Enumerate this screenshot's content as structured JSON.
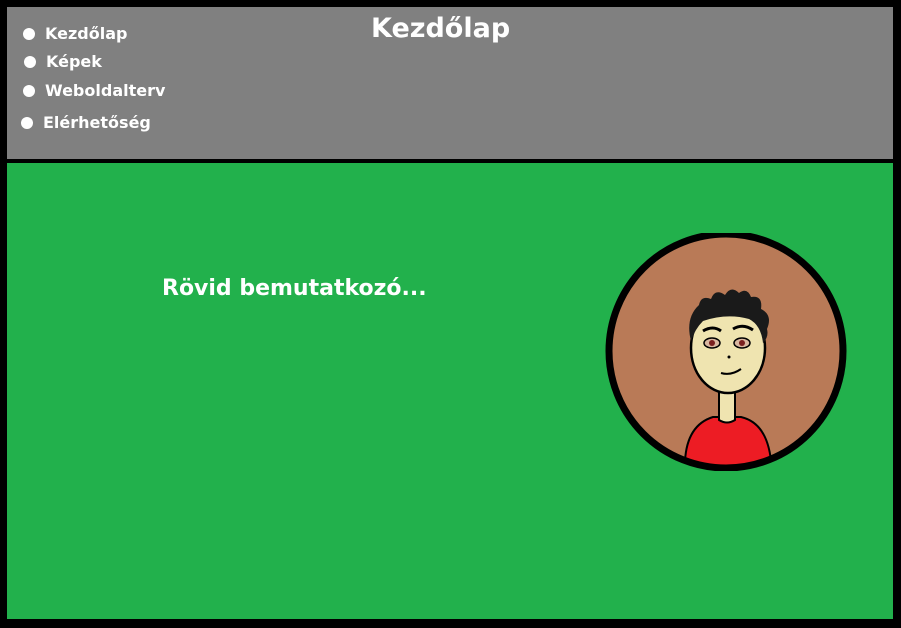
{
  "header": {
    "title": "Kezdőlap",
    "nav": [
      {
        "label": "Kezdőlap"
      },
      {
        "label": "Képek"
      },
      {
        "label": "Weboldalterv"
      },
      {
        "label": "Elérhetőség"
      }
    ]
  },
  "main": {
    "intro": "Rövid bemutatkozó..."
  },
  "colors": {
    "border": "#000000",
    "header_bg": "#808080",
    "main_bg": "#22b14c",
    "text": "#ffffff",
    "avatar_bg": "#b97a57",
    "skin": "#efe4b0",
    "shirt": "#ed1c24"
  }
}
